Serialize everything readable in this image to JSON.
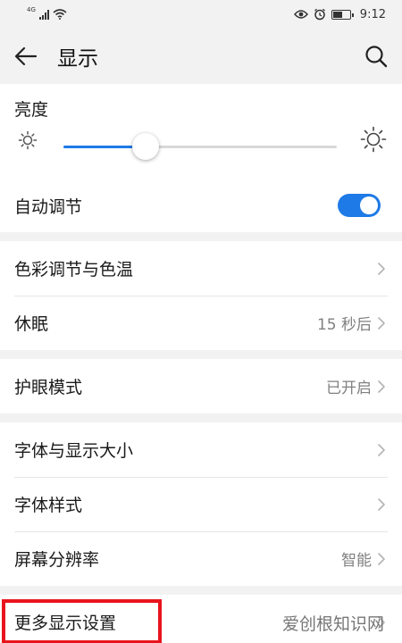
{
  "status_bar": {
    "network": "4G",
    "time": "9:12",
    "icons": [
      "signal-icon",
      "wifi-icon",
      "eye-icon",
      "alarm-icon",
      "battery-icon"
    ]
  },
  "header": {
    "title": "显示",
    "back_icon": "arrow-left-icon",
    "search_icon": "search-icon"
  },
  "brightness": {
    "label": "亮度",
    "level_percent": 30,
    "auto_label": "自动调节",
    "auto_enabled": true
  },
  "groups": [
    [
      {
        "label": "色彩调节与色温",
        "value": ""
      },
      {
        "label": "休眠",
        "value": "15 秒后"
      }
    ],
    [
      {
        "label": "护眼模式",
        "value": "已开启"
      }
    ],
    [
      {
        "label": "字体与显示大小",
        "value": ""
      },
      {
        "label": "字体样式",
        "value": ""
      },
      {
        "label": "屏幕分辨率",
        "value": "智能"
      }
    ],
    [
      {
        "label": "更多显示设置",
        "value": ""
      }
    ]
  ],
  "watermark": "爱创根知识网",
  "colors": {
    "accent": "#1e7ae6",
    "highlight": "#e8141d",
    "background": "#f2f2f2"
  }
}
